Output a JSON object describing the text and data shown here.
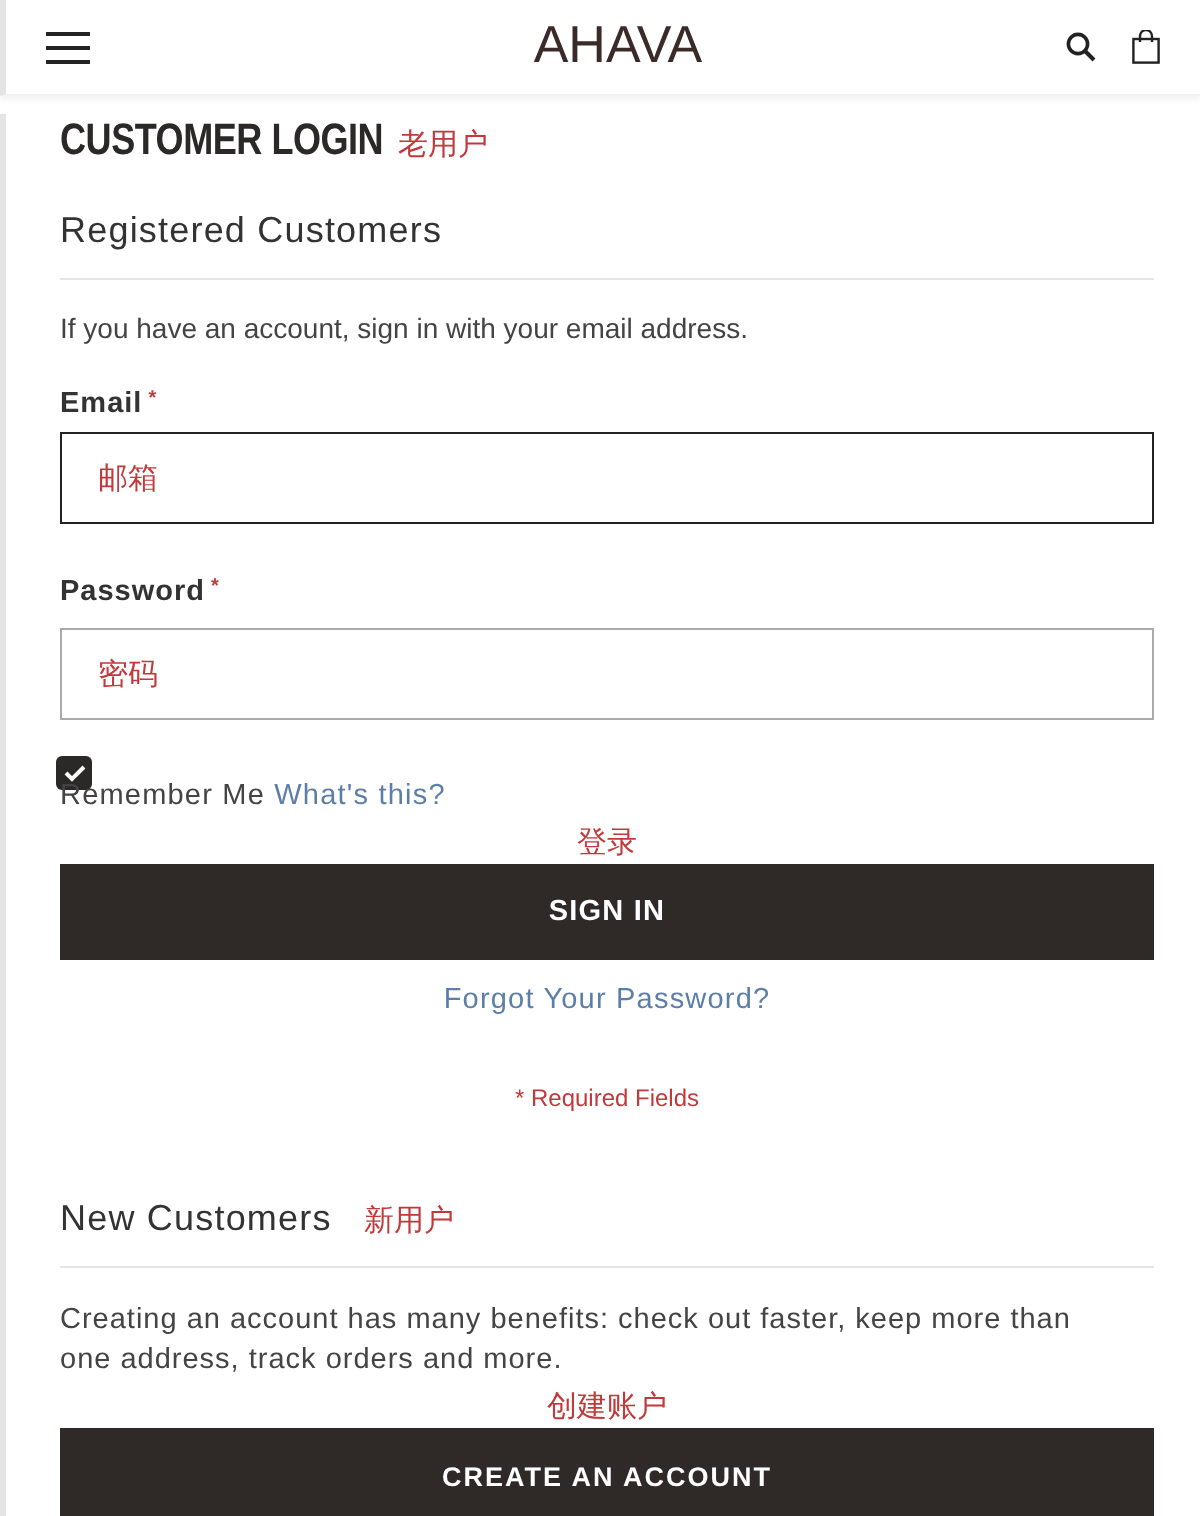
{
  "header": {
    "logo": "AHAVA"
  },
  "page_title": "CUSTOMER LOGIN",
  "page_title_note": "老用户",
  "registered": {
    "heading": "Registered Customers",
    "intro": "If you have an account, sign in with your email address.",
    "fields": [
      {
        "label": "Email",
        "required_mark": "*",
        "note": "邮箱",
        "focused": true
      },
      {
        "label": "Password",
        "required_mark": "*",
        "note": "密码",
        "focused": false
      }
    ],
    "remember": {
      "label": "Remember Me",
      "checked": true,
      "link": "What's this?"
    },
    "sign_in_note": "登录",
    "sign_in_button": "SIGN IN",
    "forgot_link": "Forgot Your Password?",
    "required_note": "* Required Fields"
  },
  "new_customers": {
    "heading": "New Customers",
    "heading_note": "新用户",
    "text": "Creating an account has many benefits: check out faster, keep more than one address, track orders and more.",
    "button_note": "创建账户",
    "button": "CREATE AN ACCOUNT"
  }
}
